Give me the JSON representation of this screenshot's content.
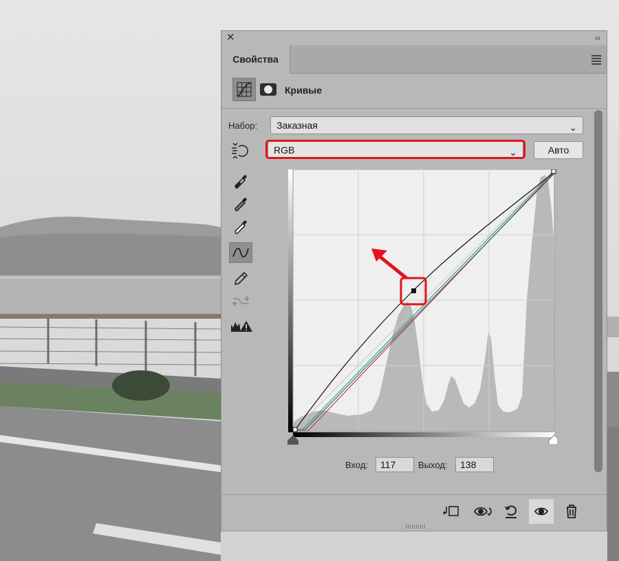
{
  "panel": {
    "tab_label": "Свойства",
    "title": "Кривые",
    "preset_label": "Набор:",
    "preset_value": "Заказная",
    "channel_value": "RGB",
    "auto_button": "Авто",
    "input_label": "Вход:",
    "input_value": "117",
    "output_label": "Выход:",
    "output_value": "138"
  },
  "icons": {
    "tools": [
      "on-image-adjust-icon",
      "black-point-eyedropper-icon",
      "gray-point-eyedropper-icon",
      "white-point-eyedropper-icon",
      "curve-points-icon",
      "pencil-icon",
      "smooth-curve-icon",
      "clipping-warning-icon"
    ],
    "footer": [
      "clip-to-layer-icon",
      "view-previous-icon",
      "reset-icon",
      "visibility-icon",
      "delete-icon"
    ]
  },
  "colors": {
    "highlight": "#e3121b",
    "panel_bg": "#b8b8b8",
    "graph_bg": "#efefef",
    "histogram": "#b9b9b9"
  }
}
